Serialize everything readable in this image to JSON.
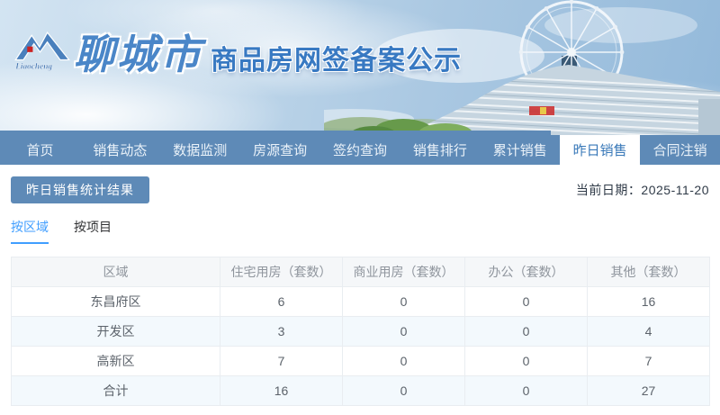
{
  "banner": {
    "logo_text": "Liaocheng",
    "city_name": "聊城市",
    "title": "商品房网签备案公示"
  },
  "nav": {
    "items": [
      {
        "label": "首页",
        "active": false
      },
      {
        "label": "销售动态",
        "active": false
      },
      {
        "label": "数据监测",
        "active": false
      },
      {
        "label": "房源查询",
        "active": false
      },
      {
        "label": "签约查询",
        "active": false
      },
      {
        "label": "销售排行",
        "active": false
      },
      {
        "label": "累计销售",
        "active": false
      },
      {
        "label": "昨日销售",
        "active": true
      },
      {
        "label": "合同注销",
        "active": false
      }
    ]
  },
  "toolbar": {
    "result_button_label": "昨日销售统计结果",
    "current_date_label": "当前日期：",
    "current_date_value": "2025-11-20"
  },
  "subtabs": [
    {
      "label": "按区域",
      "active": true
    },
    {
      "label": "按项目",
      "active": false
    }
  ],
  "table": {
    "columns": [
      "区域",
      "住宅用房（套数）",
      "商业用房（套数）",
      "办公（套数）",
      "其他（套数）"
    ],
    "rows": [
      [
        "东昌府区",
        "6",
        "0",
        "0",
        "16"
      ],
      [
        "开发区",
        "3",
        "0",
        "0",
        "4"
      ],
      [
        "高新区",
        "7",
        "0",
        "0",
        "7"
      ],
      [
        "合计",
        "16",
        "0",
        "0",
        "27"
      ]
    ]
  },
  "colors": {
    "nav_blue": "#5e8ab7",
    "title_blue": "#3879c2",
    "active_nav_text": "#3878b8",
    "subtab_active": "#409eff",
    "stripe_row": "#f3f9fd",
    "header_text": "#8f959d",
    "cell_text": "#5c636b",
    "logo_red": "#cc2222"
  }
}
